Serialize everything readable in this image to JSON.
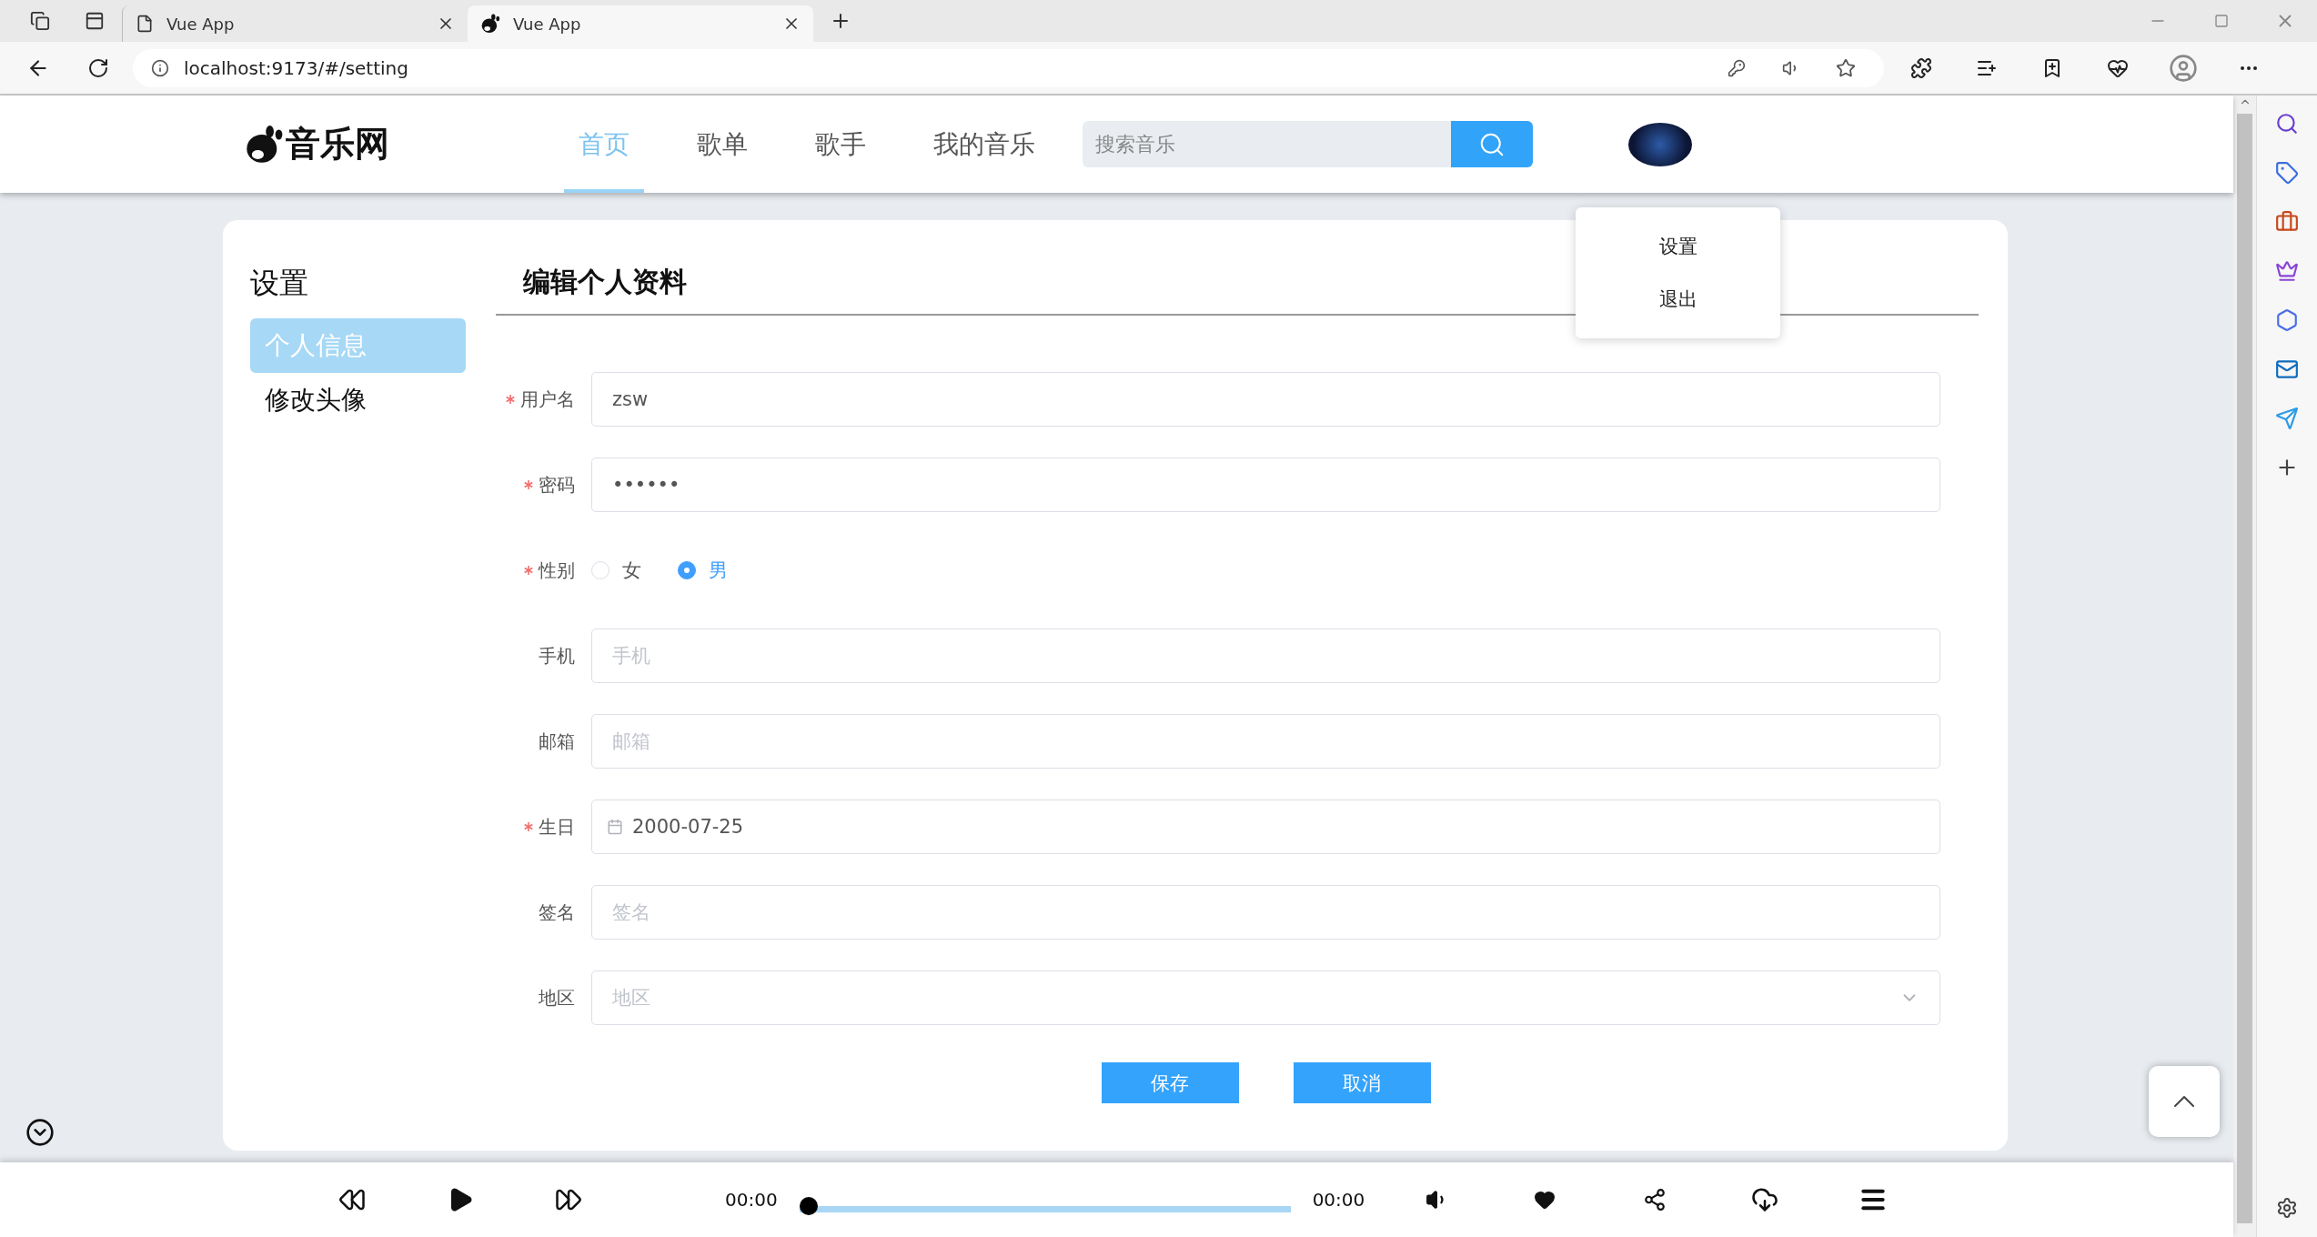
{
  "browser": {
    "tabs": [
      {
        "title": "Vue App",
        "selected": false,
        "kind": "page"
      },
      {
        "title": "Vue App",
        "selected": true,
        "kind": "logo"
      }
    ],
    "url": "localhost:9173/#/setting"
  },
  "site": {
    "logo": "音乐网",
    "nav": [
      {
        "label": "首页",
        "selected": true
      },
      {
        "label": "歌单",
        "selected": false
      },
      {
        "label": "歌手",
        "selected": false
      },
      {
        "label": "我的音乐",
        "selected": false
      }
    ],
    "search": {
      "placeholder": "搜索音乐"
    },
    "user_menu": [
      "设置",
      "退出"
    ]
  },
  "settings": {
    "title": "设置",
    "menu": [
      {
        "label": "个人信息",
        "selected": true
      },
      {
        "label": "修改头像",
        "selected": false
      }
    ],
    "heading": "编辑个人资料",
    "fields": [
      {
        "kind": "text",
        "label": "用户名",
        "required": true,
        "value": "zsw"
      },
      {
        "kind": "password",
        "label": "密码",
        "required": true,
        "value": "••••••"
      },
      {
        "kind": "radio",
        "label": "性别",
        "required": true,
        "options": [
          {
            "label": "女",
            "selected": false
          },
          {
            "label": "男",
            "selected": true
          }
        ]
      },
      {
        "kind": "text",
        "label": "手机",
        "required": false,
        "placeholder": "手机"
      },
      {
        "kind": "text",
        "label": "邮箱",
        "required": false,
        "placeholder": "邮箱"
      },
      {
        "kind": "date",
        "label": "生日",
        "required": true,
        "value": "2000-07-25"
      },
      {
        "kind": "text",
        "label": "签名",
        "required": false,
        "placeholder": "签名"
      },
      {
        "kind": "select",
        "label": "地区",
        "required": false,
        "placeholder": "地区"
      }
    ],
    "buttons": [
      "保存",
      "取消"
    ]
  },
  "player": {
    "current_time": "00:00",
    "total_time": "00:00",
    "level": 0
  }
}
